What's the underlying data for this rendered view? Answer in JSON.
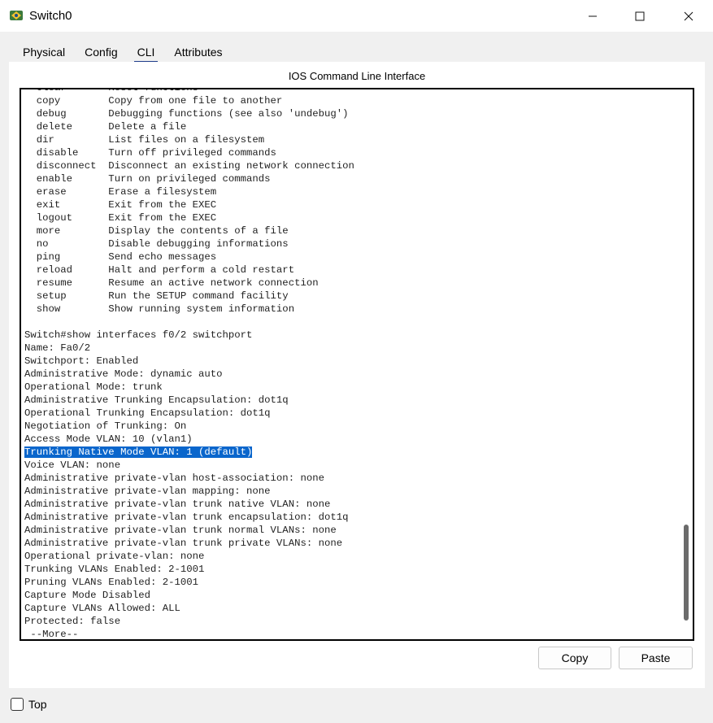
{
  "window": {
    "title": "Switch0",
    "icon": "packet-tracer-switch-icon"
  },
  "controls": {
    "minimize": "minimize-icon",
    "maximize": "maximize-icon",
    "close": "close-icon"
  },
  "tabs": [
    {
      "label": "Physical"
    },
    {
      "label": "Config"
    },
    {
      "label": "CLI",
      "active": true
    },
    {
      "label": "Attributes"
    }
  ],
  "panel": {
    "title": "IOS Command Line Interface"
  },
  "terminal": {
    "lines": [
      "  clear       Reset functions",
      "  copy        Copy from one file to another",
      "  debug       Debugging functions (see also 'undebug')",
      "  delete      Delete a file",
      "  dir         List files on a filesystem",
      "  disable     Turn off privileged commands",
      "  disconnect  Disconnect an existing network connection",
      "  enable      Turn on privileged commands",
      "  erase       Erase a filesystem",
      "  exit        Exit from the EXEC",
      "  logout      Exit from the EXEC",
      "  more        Display the contents of a file",
      "  no          Disable debugging informations",
      "  ping        Send echo messages",
      "  reload      Halt and perform a cold restart",
      "  resume      Resume an active network connection",
      "  setup       Run the SETUP command facility",
      "  show        Show running system information",
      "",
      "Switch#show interfaces f0/2 switchport",
      "Name: Fa0/2",
      "Switchport: Enabled",
      "Administrative Mode: dynamic auto",
      "Operational Mode: trunk",
      "Administrative Trunking Encapsulation: dot1q",
      "Operational Trunking Encapsulation: dot1q",
      "Negotiation of Trunking: On",
      "Access Mode VLAN: 10 (vlan1)",
      "Trunking Native Mode VLAN: 1 (default)",
      "Voice VLAN: none",
      "Administrative private-vlan host-association: none",
      "Administrative private-vlan mapping: none",
      "Administrative private-vlan trunk native VLAN: none",
      "Administrative private-vlan trunk encapsulation: dot1q",
      "Administrative private-vlan trunk normal VLANs: none",
      "Administrative private-vlan trunk private VLANs: none",
      "Operational private-vlan: none",
      "Trunking VLANs Enabled: 2-1001",
      "Pruning VLANs Enabled: 2-1001",
      "Capture Mode Disabled",
      "Capture VLANs Allowed: ALL",
      "Protected: false",
      " --More--"
    ],
    "highlighted_line": "Trunking Native Mode VLAN: 1 (default)"
  },
  "buttons": {
    "copy": "Copy",
    "paste": "Paste"
  },
  "footer": {
    "top_label": "Top",
    "top_checked": false
  }
}
